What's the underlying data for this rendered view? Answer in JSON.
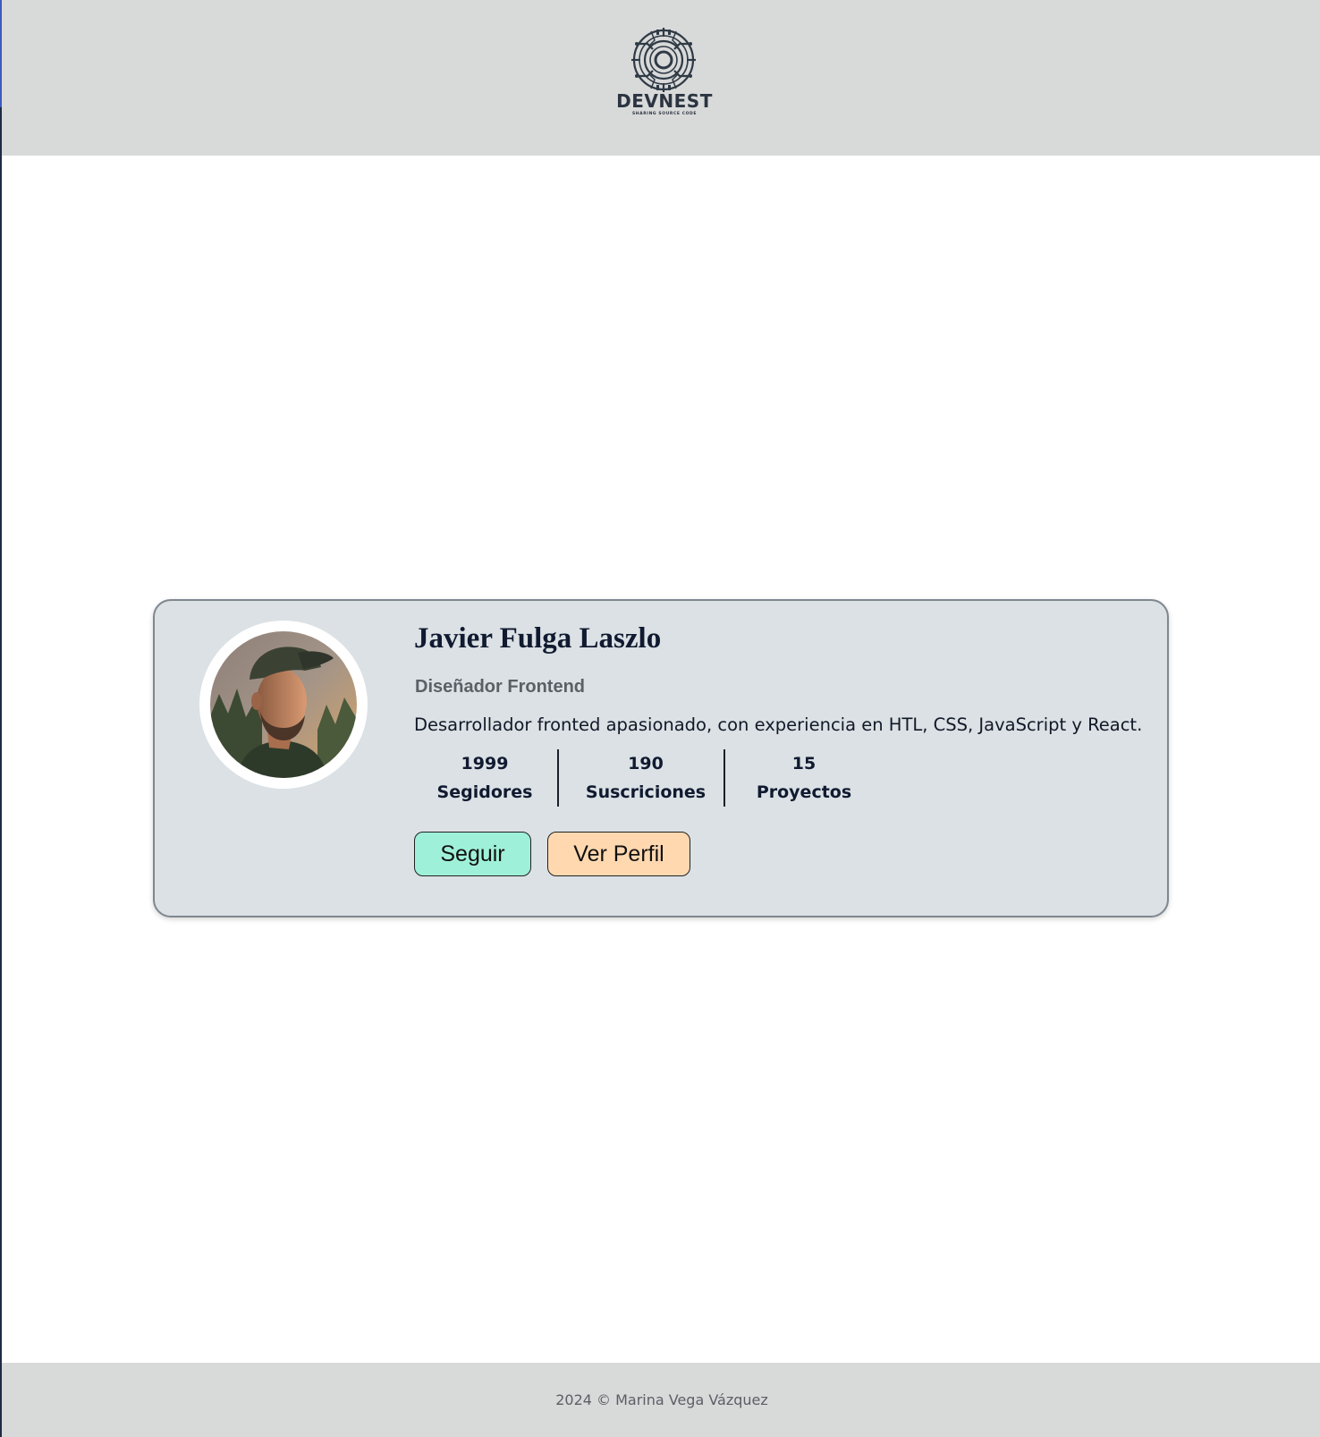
{
  "header": {
    "logo": {
      "icon": "circuit-chip-icon",
      "wordmark": "DEVNEST",
      "tagline": "SHARING SOURCE CODE"
    }
  },
  "profile": {
    "avatar_icon": "person-avatar-photo",
    "name": "Javier Fulga Laszlo",
    "role": "Diseñador Frontend",
    "bio": "Desarrollador fronted apasionado, con experiencia en HTL, CSS, JavaScript y React.",
    "stats": [
      {
        "value": "1999",
        "label": "Segidores"
      },
      {
        "value": "190",
        "label": "Suscriciones"
      },
      {
        "value": "15",
        "label": "Proyectos"
      }
    ],
    "buttons": {
      "follow_label": "Seguir",
      "profile_label": "Ver Perfil"
    }
  },
  "footer": {
    "copyright": "2024 © Marina Vega Vázquez"
  },
  "colors": {
    "header_bg": "#d8d9d9",
    "card_bg": "#dbe1e4",
    "follow_button": "#9ff0d8",
    "profile_button": "#ffd8b0",
    "name_text": "#101a30"
  }
}
